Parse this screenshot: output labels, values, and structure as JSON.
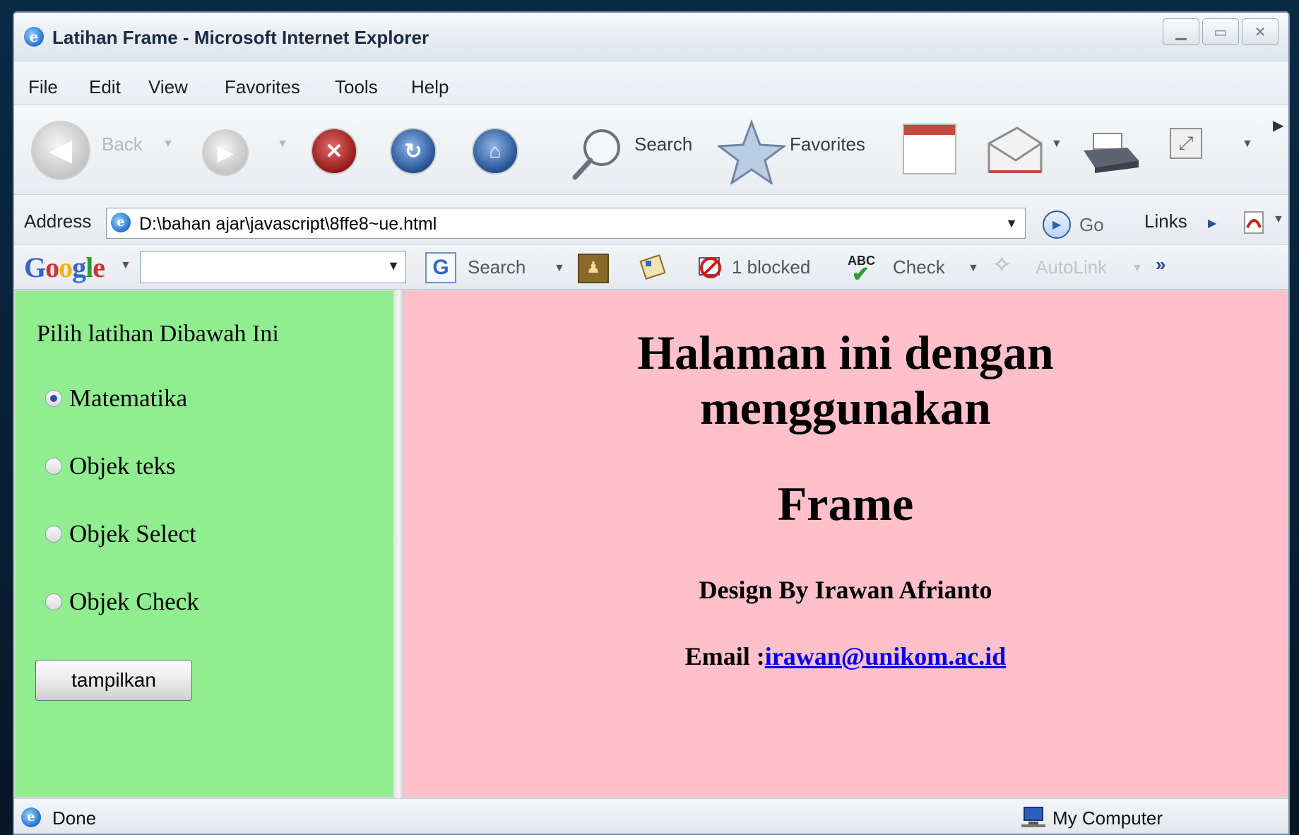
{
  "window": {
    "title": "Latihan Frame - Microsoft Internet Explorer",
    "controls": [
      "minimize",
      "maximize",
      "close"
    ]
  },
  "menu": [
    "File",
    "Edit",
    "View",
    "Favorites",
    "Tools",
    "Help"
  ],
  "toolbar": {
    "back_label": "Back",
    "search_label": "Search",
    "favorites_label": "Favorites"
  },
  "address": {
    "label": "Address",
    "value": "D:\\bahan ajar\\javascript\\8ffe8~ue.html",
    "go_label": "Go",
    "links_label": "Links"
  },
  "googlebar": {
    "logo": "Google",
    "search_label": "Search",
    "blocked_label": "1 blocked",
    "check_label": "Check",
    "autolink_label": "AutoLink",
    "more_label": "»"
  },
  "left_frame": {
    "title": "Pilih latihan Dibawah Ini",
    "options": [
      {
        "label": "Matematika",
        "selected": true
      },
      {
        "label": "Objek teks",
        "selected": false
      },
      {
        "label": "Objek Select",
        "selected": false
      },
      {
        "label": "Objek Check",
        "selected": false
      }
    ],
    "button_label": "tampilkan",
    "background": "#90ee90"
  },
  "right_frame": {
    "heading_line1": "Halaman ini dengan",
    "heading_line2": "menggunakan",
    "heading_line3": "Frame",
    "design_by": "Design By Irawan Afrianto",
    "email_label": "Email :",
    "email_link": "irawan@unikom.ac.id",
    "background": "#ffc0cb"
  },
  "status": {
    "text": "Done",
    "zone": "My Computer"
  }
}
